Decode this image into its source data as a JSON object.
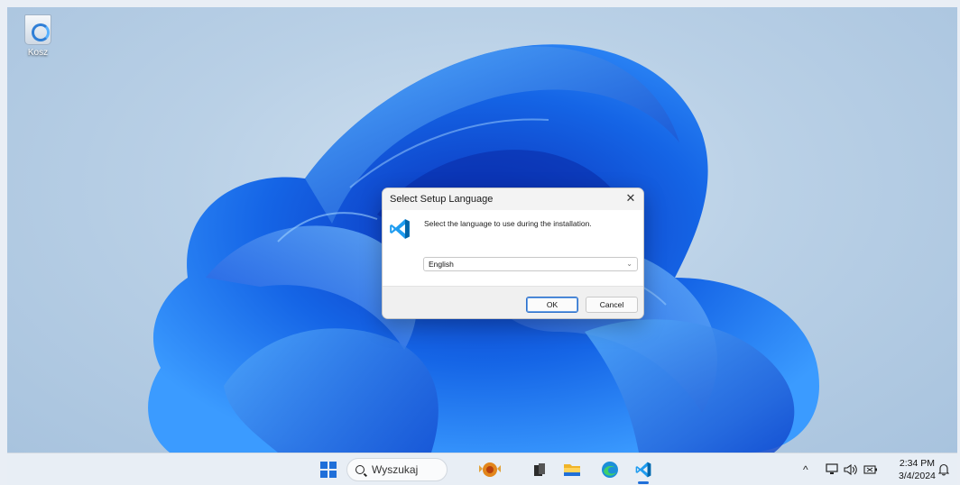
{
  "desktop": {
    "icons": [
      {
        "label": "Kosz",
        "icon": "recycle-bin-icon"
      }
    ]
  },
  "dialog": {
    "title": "Select Setup Language",
    "close_glyph": "✕",
    "prompt": "Select the language to use during the installation.",
    "language": {
      "selected": "English"
    },
    "ok_label": "OK",
    "cancel_label": "Cancel",
    "icon": "vscode-icon"
  },
  "taskbar": {
    "search_placeholder": "Wyszukaj",
    "pinned": [
      "start-icon",
      "widgets-icon",
      "task-view-icon",
      "file-explorer-icon",
      "edge-icon",
      "vscode-icon"
    ],
    "tray": {
      "chevron": "^",
      "time": "2:34 PM",
      "date": "3/4/2024"
    }
  },
  "colors": {
    "accent": "#1f6fd9",
    "vscode_blue": "#0065a9",
    "vscode_light": "#1f9cf0"
  }
}
